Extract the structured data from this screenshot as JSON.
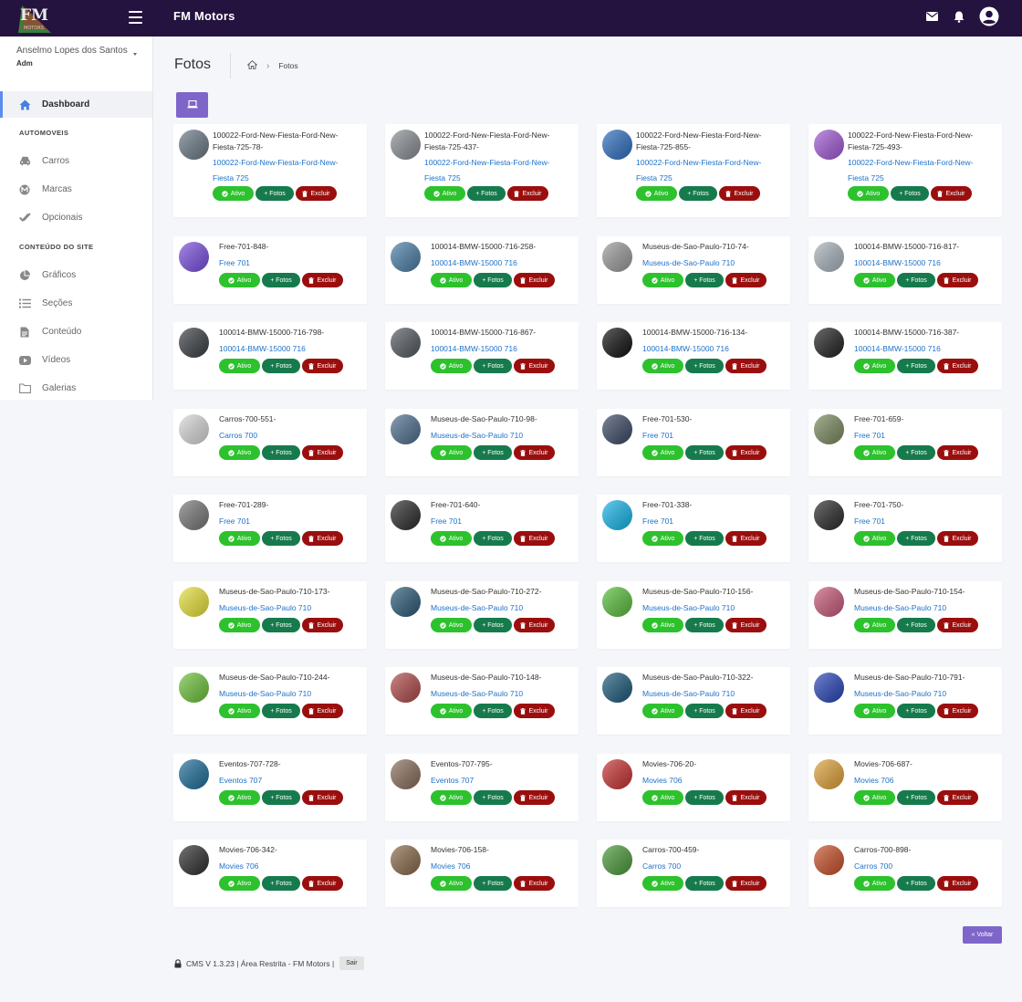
{
  "topbar": {
    "title": "FM Motors",
    "logo_text": "FM",
    "logo_sub": "MOTORS"
  },
  "user": {
    "name": "Anselmo Lopes dos Santos",
    "role": "Adm"
  },
  "sidebar": {
    "dashboard": "Dashboard",
    "section1": "AUTOMOVEIS",
    "carros": "Carros",
    "marcas": "Marcas",
    "opcionais": "Opcionais",
    "section2": "CONTEÚDO DO SITE",
    "graficos": "Gráficos",
    "secoes": "Seções",
    "conteudo": "Conteúdo",
    "videos": "Vídeos",
    "galerias": "Galerias"
  },
  "page": {
    "title": "Fotos",
    "breadcrumb": "Fotos"
  },
  "buttons": {
    "ativo": "Ativo",
    "fotos": "+ Fotos",
    "excluir": "Excluir",
    "voltar": "« Voltar"
  },
  "photos": [
    {
      "name": "100022-Ford-New-Fiesta-Ford-New-Fiesta-725-78-",
      "category": "100022-Ford-New-Fiesta-Ford-New-Fiesta 725",
      "thumb": "#6b7a86"
    },
    {
      "name": "100022-Ford-New-Fiesta-Ford-New-Fiesta-725-437-",
      "category": "100022-Ford-New-Fiesta-Ford-New-Fiesta 725",
      "thumb": "#8a8f96"
    },
    {
      "name": "100022-Ford-New-Fiesta-Ford-New-Fiesta-725-855-",
      "category": "100022-Ford-New-Fiesta-Ford-New-Fiesta 725",
      "thumb": "#2f6fc0"
    },
    {
      "name": "100022-Ford-New-Fiesta-Ford-New-Fiesta-725-493-",
      "category": "100022-Ford-New-Fiesta-Ford-New-Fiesta 725",
      "thumb": "#a25ad6"
    },
    {
      "name": "Free-701-848-",
      "category": "Free 701",
      "thumb": "#7b4fe0"
    },
    {
      "name": "100014-BMW-15000-716-258-",
      "category": "100014-BMW-15000 716",
      "thumb": "#4a7fa8"
    },
    {
      "name": "Museus-de-Sao-Paulo-710-74-",
      "category": "Museus-de-Sao-Paulo 710",
      "thumb": "#9a9a9a"
    },
    {
      "name": "100014-BMW-15000-716-817-",
      "category": "100014-BMW-15000 716",
      "thumb": "#a9b4bd"
    },
    {
      "name": "100014-BMW-15000-716-798-",
      "category": "100014-BMW-15000 716",
      "thumb": "#3b3f44"
    },
    {
      "name": "100014-BMW-15000-716-867-",
      "category": "100014-BMW-15000 716",
      "thumb": "#555a60"
    },
    {
      "name": "100014-BMW-15000-716-134-",
      "category": "100014-BMW-15000 716",
      "thumb": "#111111"
    },
    {
      "name": "100014-BMW-15000-716-387-",
      "category": "100014-BMW-15000 716",
      "thumb": "#222222"
    },
    {
      "name": "Carros-700-551-",
      "category": "Carros 700",
      "thumb": "#d9d9d9"
    },
    {
      "name": "Museus-de-Sao-Paulo-710-98-",
      "category": "Museus-de-Sao-Paulo 710",
      "thumb": "#4f6f8f"
    },
    {
      "name": "Free-701-530-",
      "category": "Free 701",
      "thumb": "#3c4a66"
    },
    {
      "name": "Free-701-659-",
      "category": "Free 701",
      "thumb": "#7a8b5e"
    },
    {
      "name": "Free-701-289-",
      "category": "Free 701",
      "thumb": "#777777"
    },
    {
      "name": "Free-701-640-",
      "category": "Free 701",
      "thumb": "#2b2b2b"
    },
    {
      "name": "Free-701-338-",
      "category": "Free 701",
      "thumb": "#17b5ea"
    },
    {
      "name": "Free-701-750-",
      "category": "Free 701",
      "thumb": "#2a2a2a"
    },
    {
      "name": "Museus-de-Sao-Paulo-710-173-",
      "category": "Museus-de-Sao-Paulo 710",
      "thumb": "#e8e23a"
    },
    {
      "name": "Museus-de-Sao-Paulo-710-272-",
      "category": "Museus-de-Sao-Paulo 710",
      "thumb": "#2d5a78"
    },
    {
      "name": "Museus-de-Sao-Paulo-710-156-",
      "category": "Museus-de-Sao-Paulo 710",
      "thumb": "#5abf3c"
    },
    {
      "name": "Museus-de-Sao-Paulo-710-154-",
      "category": "Museus-de-Sao-Paulo 710",
      "thumb": "#c85a7a"
    },
    {
      "name": "Museus-de-Sao-Paulo-710-244-",
      "category": "Museus-de-Sao-Paulo 710",
      "thumb": "#6ec43a"
    },
    {
      "name": "Museus-de-Sao-Paulo-710-148-",
      "category": "Museus-de-Sao-Paulo 710",
      "thumb": "#b04a4a"
    },
    {
      "name": "Museus-de-Sao-Paulo-710-322-",
      "category": "Museus-de-Sao-Paulo 710",
      "thumb": "#1d5a7a"
    },
    {
      "name": "Museus-de-Sao-Paulo-710-791-",
      "category": "Museus-de-Sao-Paulo 710",
      "thumb": "#2846b8"
    },
    {
      "name": "Eventos-707-728-",
      "category": "Eventos 707",
      "thumb": "#1d6e99"
    },
    {
      "name": "Eventos-707-795-",
      "category": "Eventos 707",
      "thumb": "#8a6e5a"
    },
    {
      "name": "Movies-706-20-",
      "category": "Movies 706",
      "thumb": "#c83232"
    },
    {
      "name": "Movies-706-687-",
      "category": "Movies 706",
      "thumb": "#e0a23a"
    },
    {
      "name": "Movies-706-342-",
      "category": "Movies 706",
      "thumb": "#2f2f2f"
    },
    {
      "name": "Movies-706-158-",
      "category": "Movies 706",
      "thumb": "#8a6a4a"
    },
    {
      "name": "Carros-700-459-",
      "category": "Carros 700",
      "thumb": "#4a9a3a"
    },
    {
      "name": "Carros-700-898-",
      "category": "Carros 700",
      "thumb": "#c8502a"
    }
  ],
  "footer": {
    "text": "CMS V 1.3.23 | Área Restrita - FM Motors |",
    "logout": "Sair"
  },
  "colors": {
    "topbar": "#24123f",
    "accent": "#7e65c9",
    "active": "#2dc22d",
    "fotos": "#167a4d",
    "excluir": "#9b0e0e",
    "link": "#1f72c8"
  }
}
